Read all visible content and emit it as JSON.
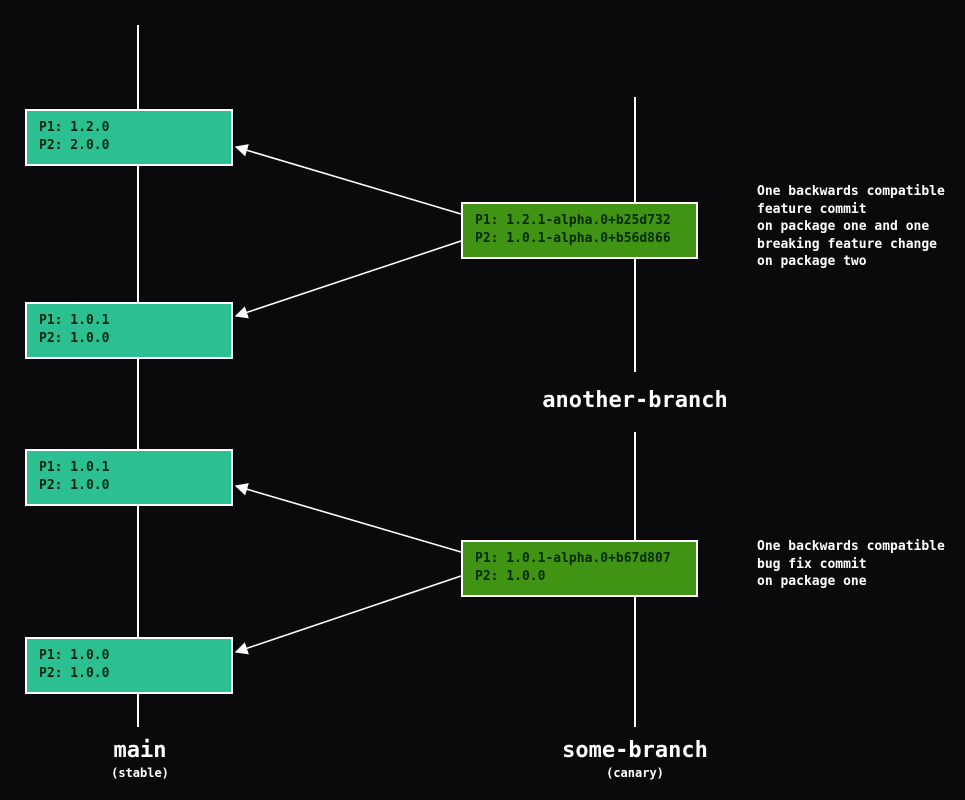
{
  "colors": {
    "bg": "#0a0a0c",
    "stable": "#2bbf91",
    "canary": "#409313",
    "line": "#ffffff"
  },
  "main": {
    "title": "main",
    "subtitle": "(stable)",
    "commits": [
      {
        "p1": "P1: 1.2.0",
        "p2": "P2: 2.0.0"
      },
      {
        "p1": "P1: 1.0.1",
        "p2": "P2: 1.0.0"
      },
      {
        "p1": "P1: 1.0.1",
        "p2": "P2: 1.0.0"
      },
      {
        "p1": "P1: 1.0.0",
        "p2": "P2: 1.0.0"
      }
    ]
  },
  "another": {
    "title": "another-branch",
    "commit": {
      "p1": "P1: 1.2.1-alpha.0+b25d732",
      "p2": "P2: 1.0.1-alpha.0+b56d866"
    },
    "note": "One backwards compatible\nfeature commit\non package one and one\nbreaking feature change\non package two"
  },
  "some": {
    "title": "some-branch",
    "subtitle": "(canary)",
    "commit": {
      "p1": "P1: 1.0.1-alpha.0+b67d807",
      "p2": "P2: 1.0.0"
    },
    "note": "One backwards compatible\nbug fix commit\non package one"
  }
}
